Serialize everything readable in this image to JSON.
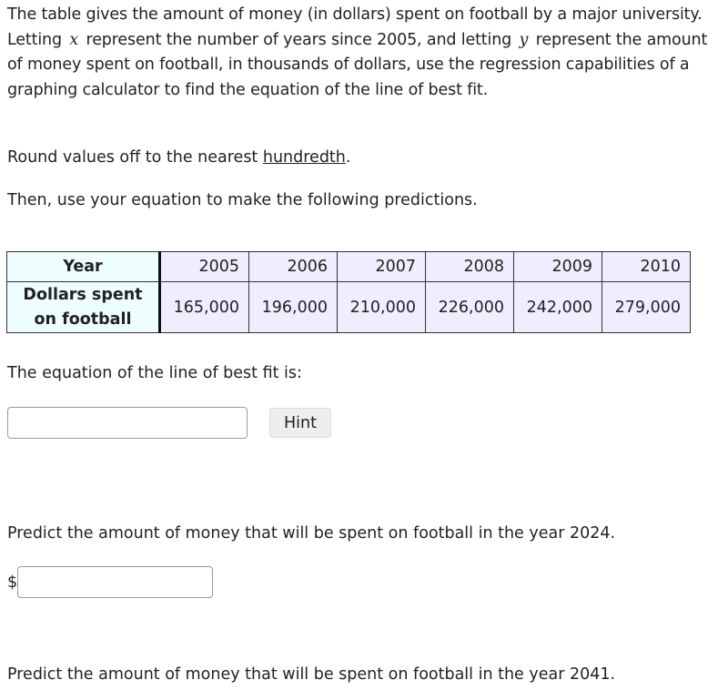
{
  "intro": {
    "part1": "The table gives the amount of money (in dollars) spent on football by a major university. Letting",
    "var_x": "x",
    "part2": "represent the number of years since 2005, and letting",
    "var_y": "y",
    "part3": "represent the amount of money spent on football, in thousands of dollars, use the regression capabilities of a graphing calculator to find the equation of the line of best fit."
  },
  "rounding": {
    "prefix": "Round values off to the nearest ",
    "link": "hundredth",
    "suffix": "."
  },
  "then_instruction": "Then, use your equation to make the following predictions.",
  "table": {
    "row_headers": [
      "Year",
      "Dollars spent on football"
    ],
    "years": [
      "2005",
      "2006",
      "2007",
      "2008",
      "2009",
      "2010"
    ],
    "dollars": [
      "165,000",
      "196,000",
      "210,000",
      "226,000",
      "242,000",
      "279,000"
    ],
    "colors": {
      "header_bg": "#eefeff",
      "cell_bg": "#eeeeff"
    }
  },
  "equation": {
    "label": "The equation of the line of best fit is:",
    "value": "",
    "placeholder": "",
    "hint_label": "Hint"
  },
  "prediction_1": {
    "label": "Predict the amount of money that will be spent on football in the year 2024.",
    "currency": "$",
    "value": ""
  },
  "prediction_2": {
    "label": "Predict the amount of money that will be spent on football in the year 2041."
  }
}
